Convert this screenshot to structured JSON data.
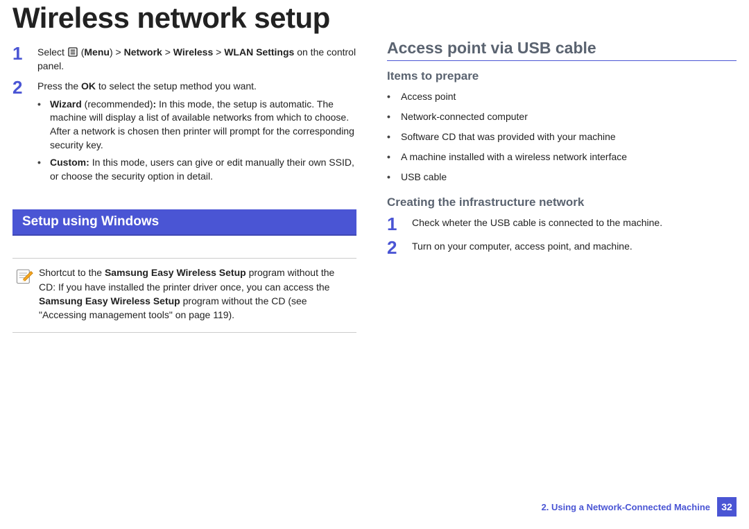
{
  "title": "Wireless network setup",
  "left": {
    "step1": {
      "num": "1",
      "prefix": "Select ",
      "menu_label": "Menu",
      "path_sep": " > ",
      "p1": "Network",
      "p2": "Wireless",
      "p3": "WLAN Settings",
      "suffix": " on the control panel."
    },
    "step2": {
      "num": "2",
      "line1a": "Press the ",
      "line1b": "OK",
      "line1c": " to select the setup method you want.",
      "bullet1_head": "Wizard",
      "bullet1_rec": " (recommended)",
      "bullet1_colon": ": ",
      "bullet1_body": "In this mode, the setup is automatic. The machine will display a list of available networks from which to choose. After a network is chosen then printer will prompt for the corresponding security key.",
      "bullet2_head": "Custom",
      "bullet2_colon": ": ",
      "bullet2_body": "In this mode, users can give or edit manually their own SSID, or choose the security option in detail."
    },
    "section_bar": "Setup using Windows",
    "note": {
      "t1": "Shortcut to the ",
      "t2": "Samsung Easy Wireless Setup",
      "t3": " program without the CD: If you have installed the printer driver once, you can access the ",
      "t4": "Samsung Easy Wireless Setup",
      "t5": " program without the CD (see \"Accessing management tools\" on page 119)."
    }
  },
  "right": {
    "h2": "Access point via USB cable",
    "items_h": "Items to prepare",
    "items": [
      "Access point",
      "Network-connected computer",
      "Software CD that was provided with your machine",
      "A machine installed with a wireless network interface",
      "USB cable"
    ],
    "infra_h": "Creating the infrastructure network",
    "s1": {
      "num": "1",
      "text": "Check wheter the USB cable is connected to the machine."
    },
    "s2": {
      "num": "2",
      "text": "Turn on your computer, access point, and machine."
    }
  },
  "footer": {
    "chapter": "2.  Using a Network-Connected Machine",
    "page": "32"
  }
}
